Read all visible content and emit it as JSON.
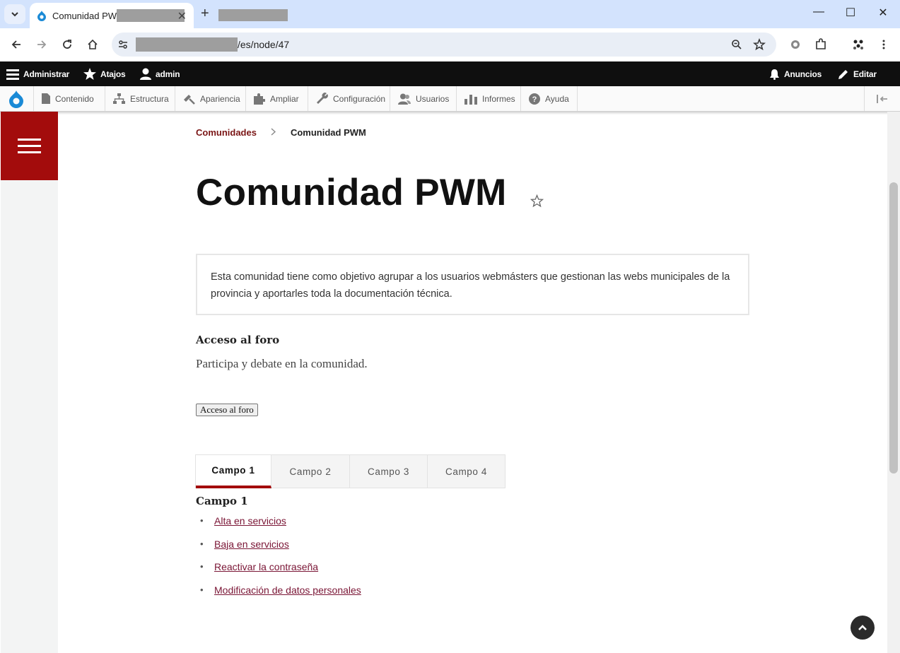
{
  "browser": {
    "tab_title": "Comunidad PW",
    "url": "/es/node/47"
  },
  "admin_toolbar": {
    "manage": "Administrar",
    "shortcuts": "Atajos",
    "user": "admin",
    "announcements": "Anuncios",
    "edit": "Editar"
  },
  "admin_menu": [
    {
      "label": "Contenido",
      "icon": "file-icon"
    },
    {
      "label": "Estructura",
      "icon": "sitemap-icon"
    },
    {
      "label": "Apariencia",
      "icon": "paintbrush-icon"
    },
    {
      "label": "Ampliar",
      "icon": "puzzle-icon"
    },
    {
      "label": "Configuración",
      "icon": "wrench-icon"
    },
    {
      "label": "Usuarios",
      "icon": "users-icon"
    },
    {
      "label": "Informes",
      "icon": "bar-chart-icon"
    },
    {
      "label": "Ayuda",
      "icon": "help-icon"
    }
  ],
  "breadcrumb": {
    "parent": "Comunidades",
    "current": "Comunidad PWM"
  },
  "page": {
    "title": "Comunidad PWM",
    "description": "Esta comunidad tiene como objetivo agrupar a los usuarios webmásters que gestionan las webs municipales de la provincia y aportarles toda la documentación técnica.",
    "forum_heading": "Acceso al foro",
    "forum_text": "Participa y debate en la comunidad.",
    "forum_button": "Acceso al foro"
  },
  "tabs": [
    {
      "label": "Campo 1",
      "active": true
    },
    {
      "label": "Campo 2",
      "active": false
    },
    {
      "label": "Campo 3",
      "active": false
    },
    {
      "label": "Campo 4",
      "active": false
    }
  ],
  "campo": {
    "heading": "Campo 1",
    "links": [
      "Alta en servicios",
      "Baja en servicios",
      "Reactivar la contraseña",
      "Modificación de datos personales"
    ]
  },
  "colors": {
    "brand_red": "#a30c0c",
    "link": "#7a1535",
    "admin_bar": "#0f0f0f"
  }
}
